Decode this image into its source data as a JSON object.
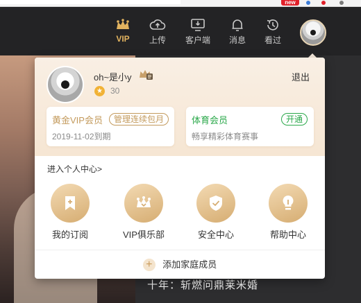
{
  "browser": {
    "badge": "new"
  },
  "nav": {
    "vip": "VIP",
    "upload": "上传",
    "client": "客户端",
    "messages": "消息",
    "history": "看过"
  },
  "background": {
    "caption": "十年：斩燃问鼎莱米婚"
  },
  "profile": {
    "name": "oh~是小y",
    "coins": "30",
    "logout": "退出"
  },
  "cards": {
    "vip": {
      "title": "黄金VIP会员",
      "button": "管理连续包月",
      "sub": "2019-11-02到期"
    },
    "sports": {
      "title": "体育会员",
      "button": "开通",
      "sub": "畅享精彩体育赛事"
    }
  },
  "personal_center": "进入个人中心>",
  "shortcuts": [
    {
      "label": "我的订阅",
      "icon": "bookmark-icon"
    },
    {
      "label": "VIP俱乐部",
      "icon": "crown-icon"
    },
    {
      "label": "安全中心",
      "icon": "shield-icon"
    },
    {
      "label": "帮助中心",
      "icon": "lightbulb-icon"
    }
  ],
  "family": {
    "label": "添加家庭成员"
  },
  "colors": {
    "gold": "#c39a5c",
    "green": "#2aa84a",
    "vipNav": "#e2b35f"
  }
}
